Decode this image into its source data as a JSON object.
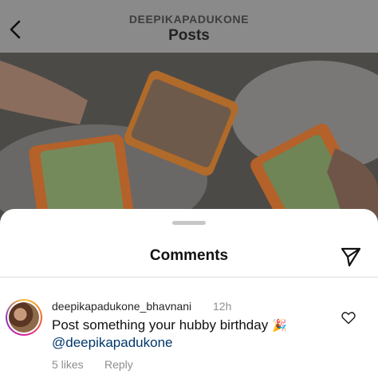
{
  "header": {
    "username": "DEEPIKAPADUKONE",
    "title": "Posts"
  },
  "icons": {
    "back": "chevron-left-icon",
    "share": "paper-plane-icon",
    "like": "heart-icon"
  },
  "sheet": {
    "title": "Comments"
  },
  "comment": {
    "username": "deepikapadukone_bhavnani",
    "time": "12h",
    "text": "Post something your hubby birthday",
    "emoji": "🎉",
    "mention": "@deepikapadukone",
    "likes": "5 likes",
    "reply_label": "Reply"
  },
  "colors": {
    "mention": "#00376b",
    "secondary_text": "#8e8e8e",
    "overlay_dim": "#7c7c7c"
  }
}
